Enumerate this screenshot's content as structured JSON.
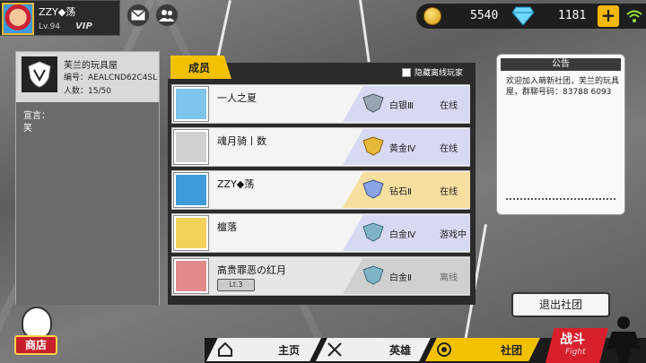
{
  "player": {
    "name": "ZZY◆荡",
    "level": "Lv.94",
    "vip": "VIP"
  },
  "currency": {
    "coins": "5540",
    "gems": "1181",
    "add": "+"
  },
  "club": {
    "name": "芙兰的玩具屋",
    "code": "编号：AEALCND62C4SL",
    "count": "人数：15/50",
    "declaration_label": "宣言：",
    "declaration": "笑"
  },
  "members": {
    "tab_label": "成员",
    "hide_offline_label": "隐藏离线玩家",
    "rows": [
      {
        "name": "一人之夏",
        "rank": "白银Ⅲ",
        "status": "在线",
        "rank_color": "#d7d8f2",
        "avatar": "#7fc4ea"
      },
      {
        "name": "魂月骑丨数",
        "rank": "黄金Ⅳ",
        "status": "在线",
        "rank_color": "#d7d8f2",
        "avatar": "#d0d0d0"
      },
      {
        "name": "ZZY◆荡",
        "rank": "钻石Ⅱ",
        "status": "在线",
        "rank_color": "#f7dfa0",
        "avatar": "#3e9ad8"
      },
      {
        "name": "檀落",
        "rank": "白金Ⅳ",
        "status": "游戏中",
        "rank_color": "#d7d8f2",
        "avatar": "#f3d25a"
      },
      {
        "name": "高贵罪恶の红月",
        "rank": "白金Ⅱ",
        "status": "离线",
        "rank_color": "#d0d0d0",
        "avatar": "#e08a8a",
        "title_badge": "Lt.3"
      }
    ]
  },
  "notice": {
    "title": "公告",
    "body": "欢迎加入萌新社团，芙兰的玩具屋，群聊号码：83788 6093"
  },
  "quit_label": "退出社团",
  "shop_label": "商店",
  "nav": {
    "home": "主页",
    "heroes": "英雄",
    "club": "社团",
    "fight": "战斗",
    "fight_sub": "Fight"
  }
}
